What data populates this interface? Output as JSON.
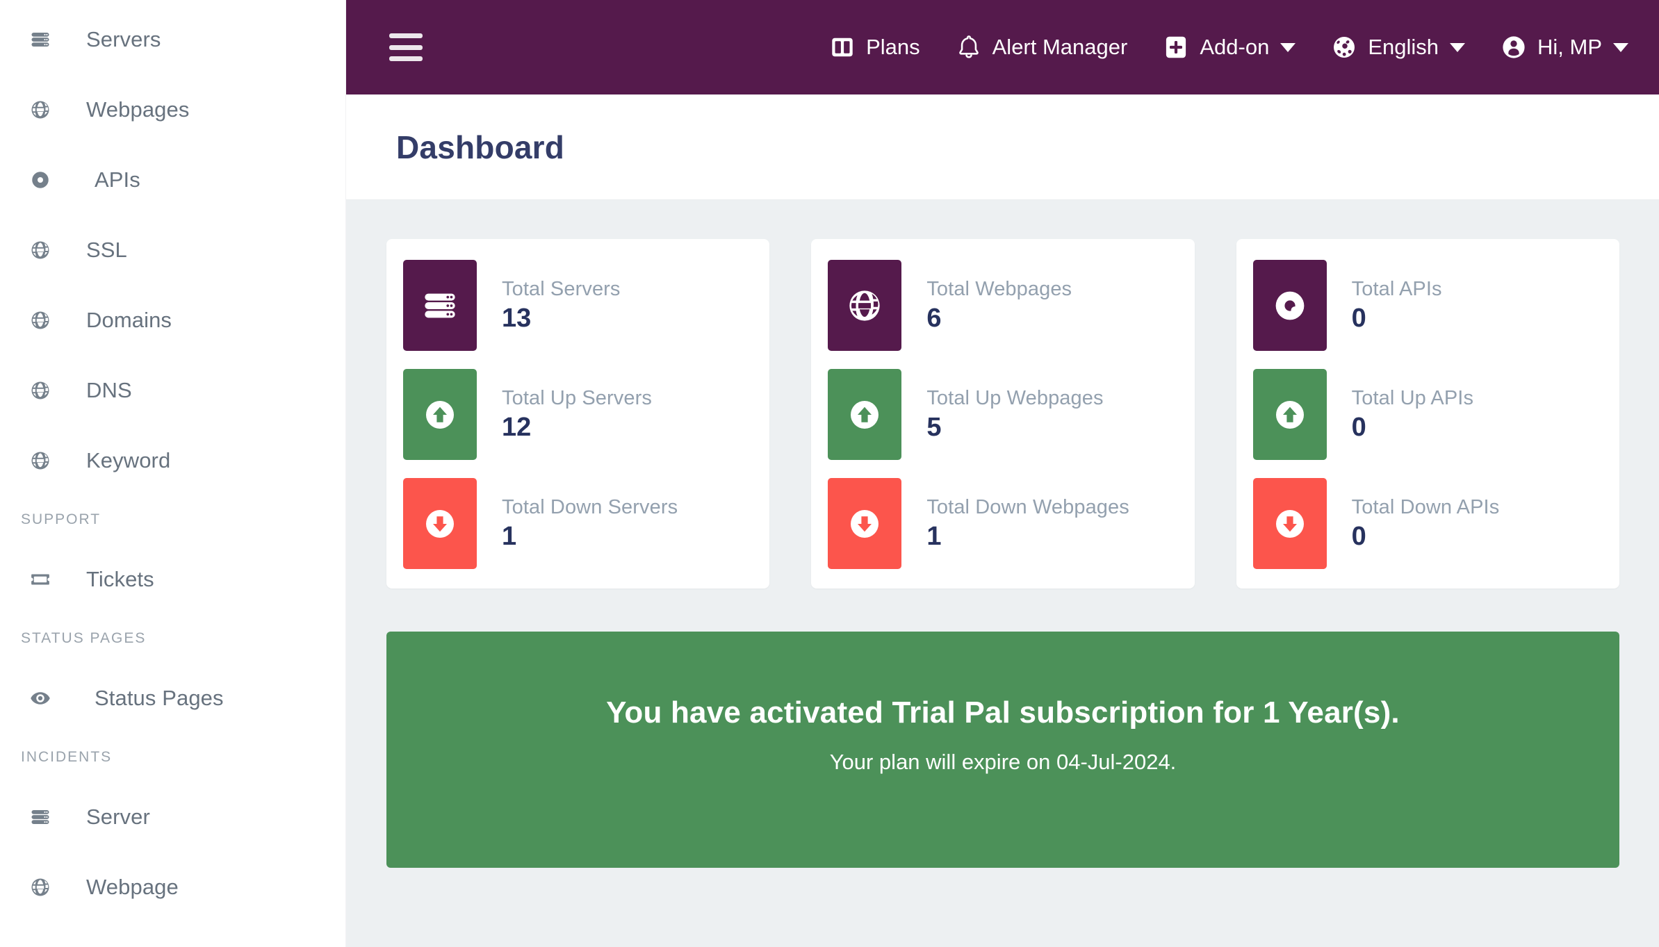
{
  "sidebar": {
    "items": [
      {
        "label": "Servers",
        "icon": "server-icon"
      },
      {
        "label": "Webpages",
        "icon": "globe-icon"
      },
      {
        "label": "APIs",
        "icon": "api-icon"
      },
      {
        "label": "SSL",
        "icon": "globe-icon"
      },
      {
        "label": "Domains",
        "icon": "globe-icon"
      },
      {
        "label": "DNS",
        "icon": "globe-icon"
      },
      {
        "label": "Keyword",
        "icon": "globe-icon"
      }
    ],
    "sections": [
      {
        "title": "SUPPORT",
        "items": [
          {
            "label": "Tickets",
            "icon": "ticket-icon"
          }
        ]
      },
      {
        "title": "STATUS PAGES",
        "items": [
          {
            "label": "Status Pages",
            "icon": "eye-icon"
          }
        ]
      },
      {
        "title": "INCIDENTS",
        "items": [
          {
            "label": "Server",
            "icon": "server-icon"
          },
          {
            "label": "Webpage",
            "icon": "globe-icon"
          }
        ]
      }
    ]
  },
  "topbar": {
    "menu_toggle": "hamburger-icon",
    "items": [
      {
        "label": "Plans",
        "icon": "layout-columns-icon",
        "caret": false
      },
      {
        "label": "Alert Manager",
        "icon": "bell-icon",
        "caret": false
      },
      {
        "label": "Add-on",
        "icon": "plus-square-icon",
        "caret": true
      },
      {
        "label": "English",
        "icon": "globe-filled-icon",
        "caret": true
      },
      {
        "label": "Hi, MP",
        "icon": "user-circle-icon",
        "caret": true
      }
    ]
  },
  "page": {
    "title": "Dashboard"
  },
  "cards": [
    {
      "name": "servers-card",
      "stats": [
        {
          "label": "Total Servers",
          "value": "13",
          "tone": "purple",
          "icon": "server-icon"
        },
        {
          "label": "Total Up Servers",
          "value": "12",
          "tone": "green",
          "icon": "arrow-up-circle-icon"
        },
        {
          "label": "Total Down Servers",
          "value": "1",
          "tone": "red",
          "icon": "arrow-down-circle-icon"
        }
      ]
    },
    {
      "name": "webpages-card",
      "stats": [
        {
          "label": "Total Webpages",
          "value": "6",
          "tone": "purple",
          "icon": "globe-icon"
        },
        {
          "label": "Total Up Webpages",
          "value": "5",
          "tone": "green",
          "icon": "arrow-up-circle-icon"
        },
        {
          "label": "Total Down Webpages",
          "value": "1",
          "tone": "red",
          "icon": "arrow-down-circle-icon"
        }
      ]
    },
    {
      "name": "apis-card",
      "stats": [
        {
          "label": "Total APIs",
          "value": "0",
          "tone": "purple",
          "icon": "api-icon"
        },
        {
          "label": "Total Up APIs",
          "value": "0",
          "tone": "green",
          "icon": "arrow-up-circle-icon"
        },
        {
          "label": "Total Down APIs",
          "value": "0",
          "tone": "red",
          "icon": "arrow-down-circle-icon"
        }
      ]
    }
  ],
  "banner": {
    "title": "You have activated Trial Pal subscription for 1 Year(s).",
    "subtitle": "Your plan will expire on 04-Jul-2024."
  },
  "colors": {
    "brand_purple": "#551a4c",
    "success_green": "#4c9159",
    "danger_red": "#fc554c",
    "page_bg": "#edf0f2",
    "title_navy": "#343d68",
    "stat_label_gray": "#93a0ae",
    "stat_value_navy": "#27325e",
    "sidebar_text": "#67727e"
  }
}
